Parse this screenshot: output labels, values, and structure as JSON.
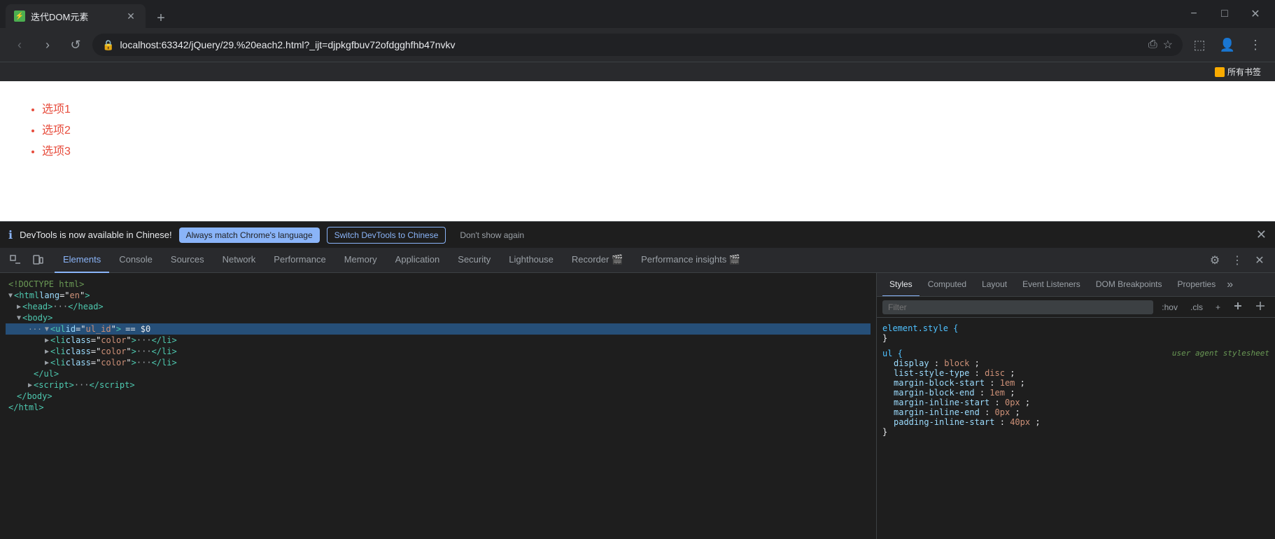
{
  "browser": {
    "tab_title": "迭代DOM元素",
    "url": "localhost:63342/jQuery/29.%20each2.html?_ijt=djpkgfbuv72ofdgghfhb47nvkv",
    "bookmarks_label": "所有书签"
  },
  "webpage": {
    "items": [
      "选项1",
      "选项2",
      "选项3"
    ]
  },
  "devtools_banner": {
    "text": "DevTools is now available in Chinese!",
    "btn1": "Always match Chrome's language",
    "btn2": "Switch DevTools to Chinese",
    "btn3": "Don't show again"
  },
  "devtools": {
    "tabs": [
      "Elements",
      "Console",
      "Sources",
      "Network",
      "Performance",
      "Memory",
      "Application",
      "Security",
      "Lighthouse",
      "Recorder",
      "Performance insights"
    ],
    "styles_tabs": [
      "Styles",
      "Computed",
      "Layout",
      "Event Listeners",
      "DOM Breakpoints",
      "Properties"
    ],
    "filter_placeholder": "Filter"
  },
  "dom": {
    "line1": "<!DOCTYPE html>",
    "line2": "<html lang=\"en\">",
    "line3": "<head>",
    "line4": "<body>",
    "line5": "<ul id=\"ul_id\"> == $0",
    "line6": "<li class=\"color\">",
    "line7": "<li class=\"color\">",
    "line8": "<li class=\"color\">",
    "line9": "</ul>",
    "line10": "<script>",
    "line11": "</body>",
    "line12": "</html>"
  },
  "styles": {
    "element_style_selector": "element.style {",
    "element_style_close": "}",
    "ul_selector": "ul {",
    "ul_close": "}",
    "ul_source": "user agent stylesheet",
    "props": [
      {
        "name": "display",
        "value": "block"
      },
      {
        "name": "list-style-type",
        "value": "disc"
      },
      {
        "name": "margin-block-start",
        "value": "1em"
      },
      {
        "name": "margin-block-end",
        "value": "1em"
      },
      {
        "name": "margin-inline-start",
        "value": "0px"
      },
      {
        "name": "margin-inline-end",
        "value": "0px"
      },
      {
        "name": "padding-inline-start",
        "value": "40px"
      }
    ]
  },
  "icons": {
    "back": "‹",
    "forward": "›",
    "reload": "↺",
    "star": "☆",
    "profile": "👤",
    "menu": "⋮",
    "close": "✕",
    "minimize": "−",
    "maximize": "□",
    "new_tab": "+",
    "info": "ⓘ",
    "expand": "▶",
    "expanded": "▼",
    "element_picker": "⬚",
    "device": "📱",
    "settings": "⚙",
    "more": "⋮",
    "chevron_down": "⌄"
  }
}
